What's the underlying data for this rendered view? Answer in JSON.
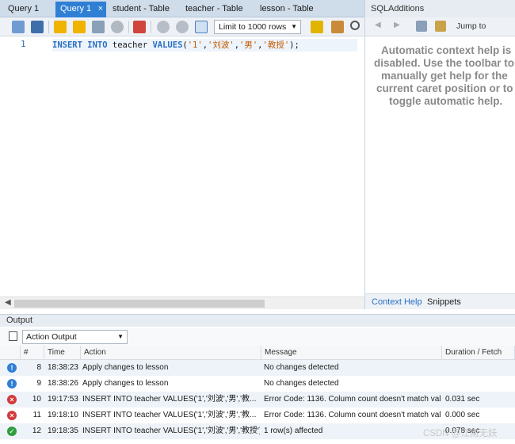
{
  "tabs": [
    {
      "label": "Query 1",
      "active": false
    },
    {
      "label": "Query 1",
      "active": true
    },
    {
      "label": "student - Table",
      "active": false
    },
    {
      "label": "teacher - Table",
      "active": false
    },
    {
      "label": "lesson - Table",
      "active": false
    }
  ],
  "tab_close_glyph": "×",
  "toolbar": {
    "icons": [
      "open-folder-icon",
      "save-icon",
      "execute-icon",
      "execute-current-icon",
      "explain-icon",
      "stop-icon",
      "toggle-error-icon",
      "commit-icon",
      "rollback-icon",
      "autocommit-icon"
    ],
    "limit_label": "Limit to 1000 rows",
    "after_icons": [
      "add-snippet-icon",
      "beautify-icon",
      "find-icon"
    ]
  },
  "editor": {
    "line_number": "1",
    "code": {
      "kw1": "INSERT",
      "kw2": "INTO",
      "ident": " teacher ",
      "kw3": "VALUES",
      "p1": "(",
      "s1": "'1'",
      "c1": ",",
      "s2": "'刘波'",
      "c2": ",",
      "s3": "'男'",
      "c3": ",",
      "s4": "'教授'",
      "end": ");"
    }
  },
  "sidebar": {
    "title": "SQLAdditions",
    "jump_label": "Jump to",
    "message_lines": [
      "Automatic context help is",
      "disabled. Use the toolbar to",
      "manually get help for the",
      "current caret position or to",
      "toggle automatic help."
    ],
    "tabs": [
      "Context Help",
      "Snippets"
    ]
  },
  "output": {
    "title": "Output",
    "selector": "Action Output",
    "columns": [
      "#",
      "Time",
      "Action",
      "Message",
      "Duration / Fetch"
    ],
    "rows": [
      {
        "status": "info",
        "num": "8",
        "time": "18:38:23",
        "action": "Apply changes to lesson",
        "message": "No changes detected",
        "duration": ""
      },
      {
        "status": "info",
        "num": "9",
        "time": "18:38:26",
        "action": "Apply changes to lesson",
        "message": "No changes detected",
        "duration": ""
      },
      {
        "status": "error",
        "num": "10",
        "time": "19:17:53",
        "action": "INSERT INTO teacher VALUES('1','刘波','男','教...",
        "message": "Error Code: 1136. Column count doesn't match val...",
        "duration": "0.031 sec"
      },
      {
        "status": "error",
        "num": "11",
        "time": "19:18:10",
        "action": "INSERT INTO teacher VALUES('1','刘波','男','教...",
        "message": "Error Code: 1136. Column count doesn't match val...",
        "duration": "0.000 sec"
      },
      {
        "status": "ok",
        "num": "12",
        "time": "19:18:35",
        "action": "INSERT INTO teacher VALUES('1','刘波','男','教授')",
        "message": "1 row(s) affected",
        "duration": "0.078 sec"
      }
    ]
  },
  "watermark": "CSDN @江南无妖",
  "colors": {
    "accent": "#2f7fd4",
    "error": "#d33b3b",
    "ok": "#2e9e3e"
  }
}
